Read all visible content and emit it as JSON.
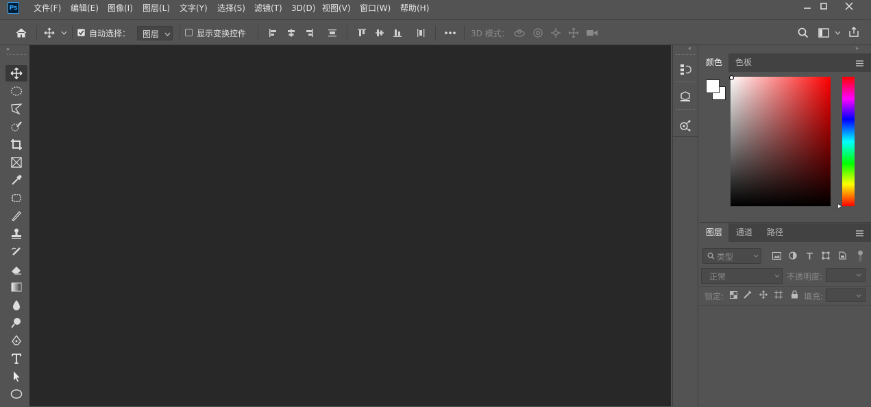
{
  "app": {
    "logo": "Ps"
  },
  "menu": {
    "items": [
      "文件(F)",
      "编辑(E)",
      "图像(I)",
      "图层(L)",
      "文字(Y)",
      "选择(S)",
      "滤镜(T)",
      "3D(D)",
      "视图(V)",
      "窗口(W)",
      "帮助(H)"
    ]
  },
  "options": {
    "auto_select_label": "自动选择：",
    "auto_select_checked": true,
    "target_value": "图层",
    "show_transform_label": "显示变换控件",
    "show_transform_checked": false,
    "mode_3d_label": "3D 模式："
  },
  "color_panel": {
    "tabs": [
      "颜色",
      "色板"
    ],
    "foreground": "#ffffff",
    "background": "#ffffff",
    "hue": "#ff0000"
  },
  "layers_panel": {
    "tabs": [
      "图层",
      "通道",
      "路径"
    ],
    "filter_placeholder": "类型",
    "blend_mode": "正常",
    "opacity_label": "不透明度:",
    "lock_label": "锁定:",
    "fill_label": "填充:"
  },
  "colors": {
    "chrome": "#535353",
    "canvas": "#282828",
    "ps_blue": "#31a8ff"
  }
}
